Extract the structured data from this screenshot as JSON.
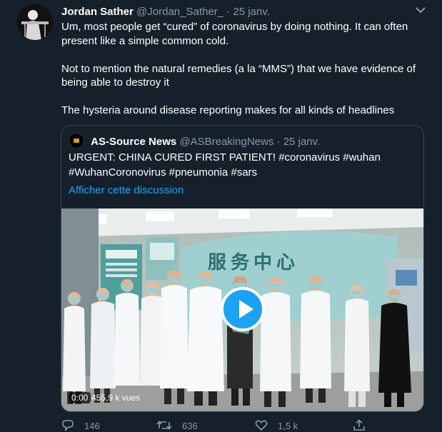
{
  "tweet": {
    "author_name": "Jordan Sather",
    "author_handle": "@Jordan_Sather_",
    "separator": "·",
    "date": "25 janv.",
    "paragraphs": [
      "Um, most people get “cured” of coronavirus by doing nothing. It can often present like a simple common cold.",
      "Not to mention the natural remedies (a la “MMS”) that we have evidence of being able to destroy it",
      "The hysteria around disease reporting makes for all kinds of headlines"
    ],
    "menu_icon": "chevron-down-icon"
  },
  "quoted": {
    "author_name": "AS-Source News",
    "author_handle": "@ASBreakingNews",
    "separator": "·",
    "date": "25 janv.",
    "text": "URGENT: CHINA CURED FIRST PATIENT! #coronavirus #wuhan #WuhanCoronovirus #pneumonia #sars",
    "show_thread": "Afficher cette discussion",
    "video": {
      "sign_text": "服务中心",
      "time": "0:00",
      "views": "455,9 k vues",
      "play_icon": "play-icon"
    }
  },
  "actions": {
    "reply_count": "146",
    "retweet_count": "636",
    "like_count": "1,5 k",
    "icons": [
      "reply-icon",
      "retweet-icon",
      "like-icon",
      "share-icon"
    ]
  },
  "colors": {
    "background": "#15202b",
    "text": "#ffffff",
    "muted": "#8899a6",
    "link": "#1da1f2",
    "border": "#38444d"
  }
}
